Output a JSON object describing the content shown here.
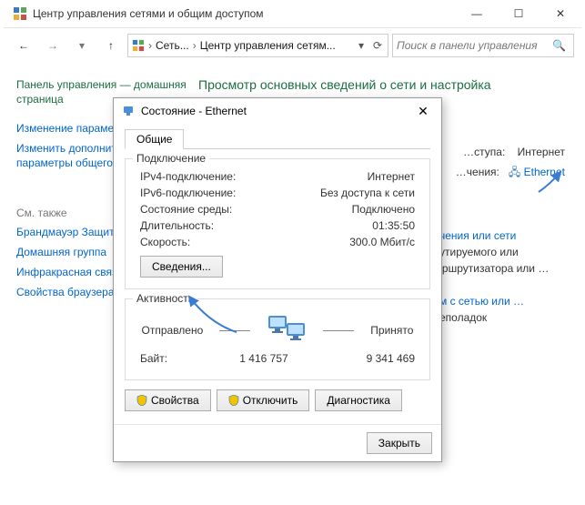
{
  "window": {
    "title": "Центр управления сетями и общим доступом",
    "minimize": "—",
    "maximize": "☐",
    "close": "✕"
  },
  "nav": {
    "back": "←",
    "fwd": "→",
    "drop": "▾",
    "up": "↑",
    "path_seg1": "Сеть...",
    "path_seg2": "Центр управления сетям...",
    "refresh": "⟳",
    "search_placeholder": "Поиск в панели управления"
  },
  "sidebar": {
    "home": "Панель управления — домашняя страница",
    "links": [
      "Изменение параметров адаптера",
      "Изменить дополнительные параметры общего доступа"
    ],
    "see_also_title": "См. также",
    "see_also": [
      "Брандмауэр Защитника Windows",
      "Домашняя группа",
      "Инфракрасная связь",
      "Свойства браузера"
    ]
  },
  "content": {
    "heading": "Просмотр основных сведений о сети и настройка подключений"
  },
  "right": {
    "access_label": "…ступа:",
    "access_value": "Интернет",
    "conn_label": "…чения:",
    "conn_value": "Ethernet",
    "link1": "…чения или сети",
    "text1": "…утируемого или маршрутизатора или …",
    "link2": "…м с сетью или …",
    "text2": "…еполадок"
  },
  "dialog": {
    "title": "Состояние - Ethernet",
    "tab": "Общие",
    "group_conn": "Подключение",
    "rows": [
      {
        "k": "IPv4-подключение:",
        "v": "Интернет"
      },
      {
        "k": "IPv6-подключение:",
        "v": "Без доступа к сети"
      },
      {
        "k": "Состояние среды:",
        "v": "Подключено"
      },
      {
        "k": "Длительность:",
        "v": "01:35:50"
      },
      {
        "k": "Скорость:",
        "v": "300.0 Мбит/с"
      }
    ],
    "details_btn": "Сведения...",
    "group_act": "Активность",
    "sent": "Отправлено",
    "recv": "Принято",
    "bytes_label": "Байт:",
    "bytes_sent": "1 416 757",
    "bytes_recv": "9 341 469",
    "props_btn": "Свойства",
    "disable_btn": "Отключить",
    "diag_btn": "Диагностика",
    "close_btn": "Закрыть"
  }
}
